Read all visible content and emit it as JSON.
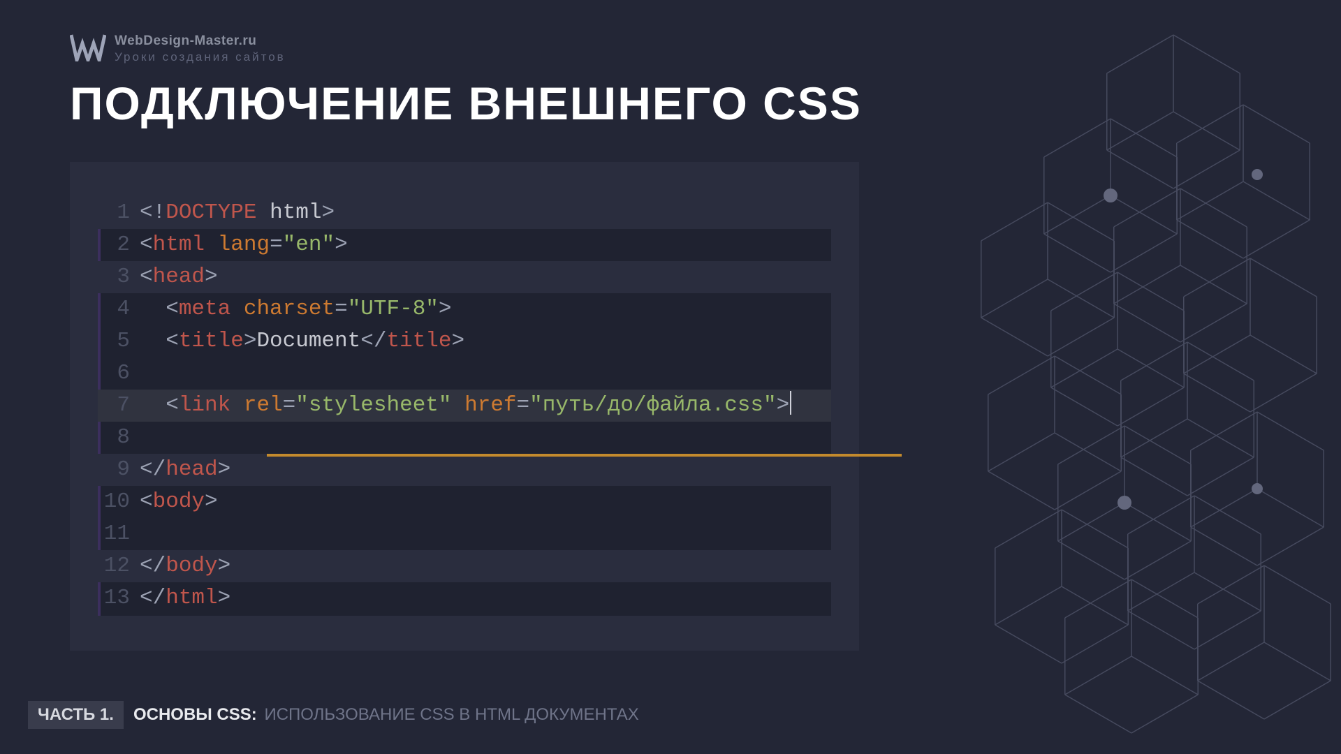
{
  "logo": {
    "site": "WebDesign-Master.ru",
    "tagline": "Уроки создания сайтов"
  },
  "title": "ПОДКЛЮЧЕНИЕ ВНЕШНЕГО CSS",
  "code": {
    "lines": [
      {
        "n": 1,
        "hl": true,
        "tokens": [
          [
            "p",
            "<!"
          ],
          [
            "doc",
            "DOCTYPE"
          ],
          [
            "p",
            " "
          ],
          [
            "txt",
            "html"
          ],
          [
            "p",
            ">"
          ]
        ]
      },
      {
        "n": 2,
        "hl": false,
        "tokens": [
          [
            "p",
            "<"
          ],
          [
            "tag",
            "html"
          ],
          [
            "p",
            " "
          ],
          [
            "attr",
            "lang"
          ],
          [
            "p",
            "="
          ],
          [
            "str",
            "\"en\""
          ],
          [
            "p",
            ">"
          ]
        ]
      },
      {
        "n": 3,
        "hl": true,
        "tokens": [
          [
            "p",
            "<"
          ],
          [
            "tag",
            "head"
          ],
          [
            "p",
            ">"
          ]
        ]
      },
      {
        "n": 4,
        "hl": false,
        "tokens": [
          [
            "p",
            "  <"
          ],
          [
            "tag",
            "meta"
          ],
          [
            "p",
            " "
          ],
          [
            "attr",
            "charset"
          ],
          [
            "p",
            "="
          ],
          [
            "str",
            "\"UTF-8\""
          ],
          [
            "p",
            ">"
          ]
        ]
      },
      {
        "n": 5,
        "hl": false,
        "tokens": [
          [
            "p",
            "  <"
          ],
          [
            "tag",
            "title"
          ],
          [
            "p",
            ">"
          ],
          [
            "txt",
            "Document"
          ],
          [
            "p",
            "</"
          ],
          [
            "tag",
            "title"
          ],
          [
            "p",
            ">"
          ]
        ]
      },
      {
        "n": 6,
        "hl": false,
        "tokens": []
      },
      {
        "n": 7,
        "hl": "7",
        "tokens": [
          [
            "p",
            "  <"
          ],
          [
            "tag",
            "link"
          ],
          [
            "p",
            " "
          ],
          [
            "attr",
            "rel"
          ],
          [
            "p",
            "="
          ],
          [
            "str",
            "\"stylesheet\""
          ],
          [
            "p",
            " "
          ],
          [
            "attr",
            "href"
          ],
          [
            "p",
            "="
          ],
          [
            "str",
            "\"путь/до/файла.css\""
          ],
          [
            "p",
            ">"
          ]
        ],
        "cursor": true
      },
      {
        "n": 8,
        "hl": false,
        "tokens": []
      },
      {
        "n": 9,
        "hl": true,
        "tokens": [
          [
            "p",
            "</"
          ],
          [
            "tag",
            "head"
          ],
          [
            "p",
            ">"
          ]
        ]
      },
      {
        "n": 10,
        "hl": false,
        "tokens": [
          [
            "p",
            "<"
          ],
          [
            "tag",
            "body"
          ],
          [
            "p",
            ">"
          ]
        ]
      },
      {
        "n": 11,
        "hl": false,
        "tokens": []
      },
      {
        "n": 12,
        "hl": true,
        "tokens": [
          [
            "p",
            "</"
          ],
          [
            "tag",
            "body"
          ],
          [
            "p",
            ">"
          ]
        ]
      },
      {
        "n": 13,
        "hl": false,
        "tokens": [
          [
            "p",
            "</"
          ],
          [
            "tag",
            "html"
          ],
          [
            "p",
            ">"
          ]
        ]
      }
    ]
  },
  "footer": {
    "chip": "ЧАСТЬ 1.",
    "strong": "ОСНОВЫ CSS:",
    "dim": "ИСПОЛЬЗОВАНИЕ CSS В HTML ДОКУМЕНТАХ"
  }
}
